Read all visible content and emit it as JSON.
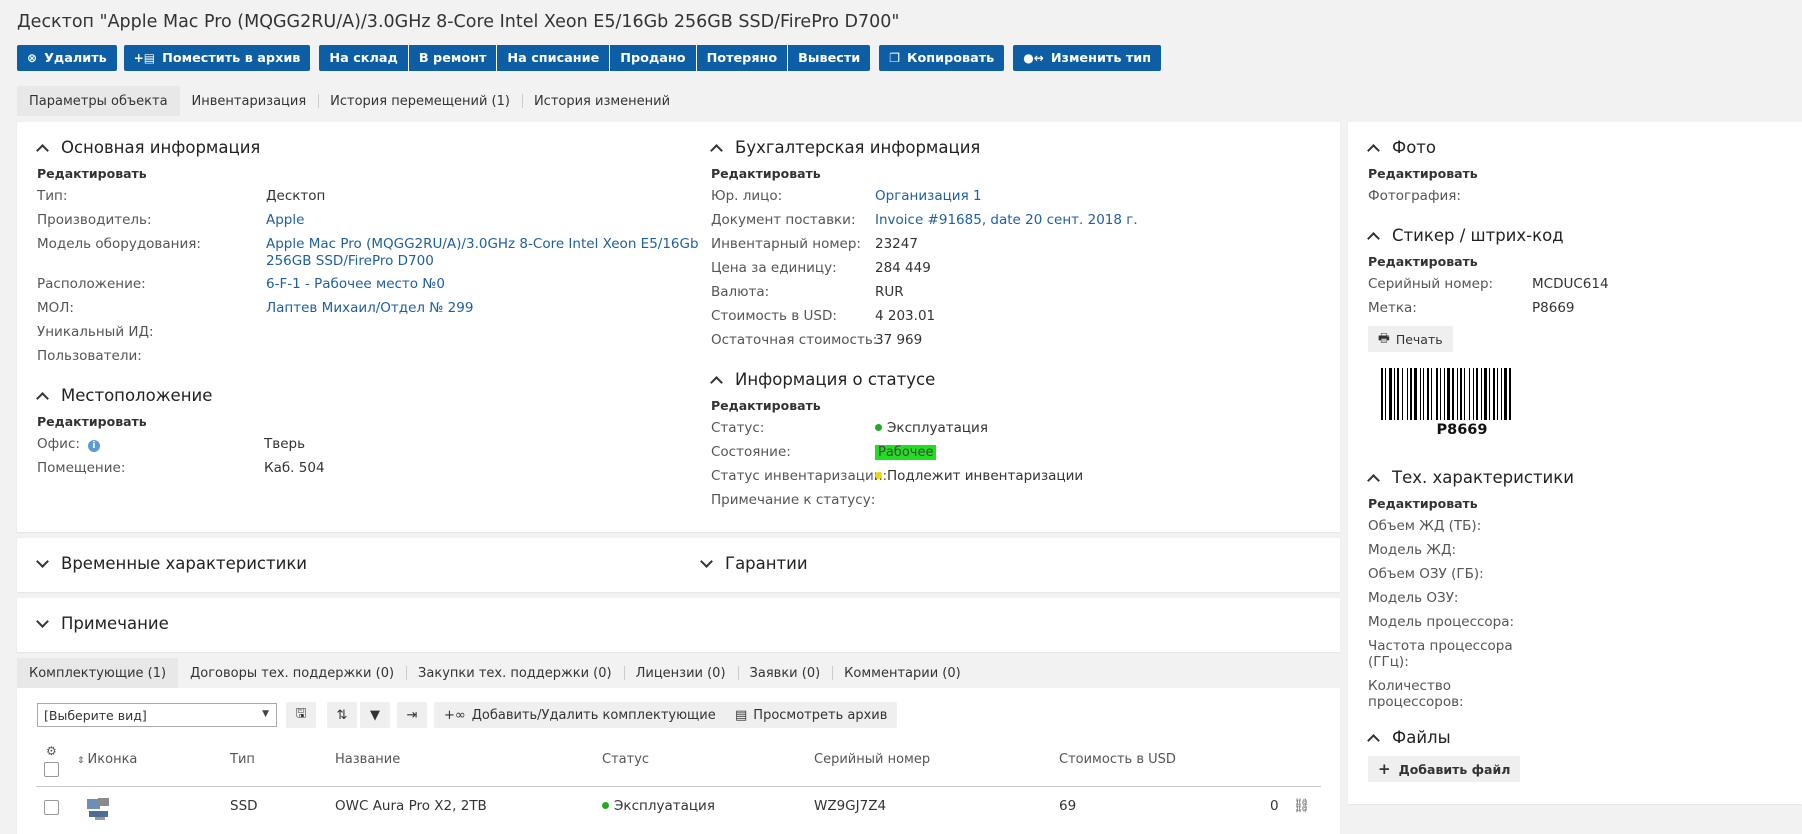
{
  "page": {
    "title": "Десктоп \"Apple Mac Pro (MQGG2RU/A)/3.0GHz 8-Core Intel Xeon E5/16Gb 256GB SSD/FirePro D700\""
  },
  "toolbar": {
    "delete": "Удалить",
    "archive": "Поместить в архив",
    "to_stock": "На склад",
    "to_repair": "В ремонт",
    "write_off": "На списание",
    "sold": "Продано",
    "lost": "Потеряно",
    "withdraw": "Вывести",
    "copy": "Копировать",
    "change_type": "Изменить тип"
  },
  "tabs": [
    "Параметры объекта",
    "Инвентаризация",
    "История перемещений (1)",
    "История изменений"
  ],
  "edit_label": "Редактировать",
  "basic": {
    "heading": "Основная информация",
    "type_label": "Тип:",
    "type_value": "Десктоп",
    "maker_label": "Производитель:",
    "maker_value": "Apple",
    "model_label": "Модель оборудования:",
    "model_value_1": "Apple Mac Pro (MQGG2RU/A)/3.0GHz 8-Core Intel Xeon E5/16Gb",
    "model_value_2": "256GB SSD/FirePro D700",
    "location_label": "Расположение:",
    "location_value": "6-F-1 - Рабочее место №0",
    "mol_label": "МОЛ:",
    "mol_value": "Лаптев Михаил/Отдел № 299",
    "uid_label": "Уникальный ИД:",
    "users_label": "Пользователи:"
  },
  "place": {
    "heading": "Местоположение",
    "office_label": "Офис:",
    "office_value": "Тверь",
    "room_label": "Помещение:",
    "room_value": "Каб. 504"
  },
  "accounting": {
    "heading": "Бухгалтерская информация",
    "entity_label": "Юр. лицо:",
    "entity_value": "Организация 1",
    "doc_label": "Документ поставки:",
    "doc_value": "Invoice #91685, date 20 сент. 2018 г.",
    "inv_label": "Инвентарный номер:",
    "inv_value": "23247",
    "price_label": "Цена за единицу:",
    "price_value": "284 449",
    "currency_label": "Валюта:",
    "currency_value": "RUR",
    "usd_label": "Стоимость в USD:",
    "usd_value": "4 203.01",
    "residual_label": "Остаточная стоимость:",
    "residual_value": "37 969"
  },
  "status": {
    "heading": "Информация о статусе",
    "status_label": "Статус:",
    "status_value": "Эксплуатация",
    "state_label": "Состояние:",
    "state_value": "Рабочее",
    "inv_label": "Статус инвентаризации:",
    "inv_value": "Подлежит инвентаризации",
    "note_label": "Примечание к статусу:",
    "colors": {
      "green": "#22aa22",
      "yellow": "#f0d800",
      "badge": "#22dd22"
    }
  },
  "collapsed": {
    "time": "Временные характеристики",
    "warranty": "Гарантии",
    "note": "Примечание"
  },
  "right": {
    "photo_heading": "Фото",
    "photo_label": "Фотография:",
    "sticker_heading": "Стикер / штрих-код",
    "serial_label": "Серийный номер:",
    "serial_value": "MCDUC614",
    "tag_label": "Метка:",
    "tag_value": "P8669",
    "print_label": "Печать",
    "barcode_text": "P8669",
    "tech_heading": "Тех. характеристики",
    "hdd_size": "Объем ЖД (ТБ):",
    "hdd_model": "Модель ЖД:",
    "ram_size": "Объем ОЗУ (ГБ):",
    "ram_model": "Модель ОЗУ:",
    "cpu_model": "Модель процессора:",
    "cpu_freq_1": "Частота процессора",
    "cpu_freq_2": "(ГГц):",
    "cpu_count_1": "Количество",
    "cpu_count_2": "процессоров:",
    "files_heading": "Файлы",
    "add_file": "Добавить файл"
  },
  "bottom_tabs": [
    "Комплектующие (1)",
    "Договоры тех. поддержки (0)",
    "Закупки тех. поддержки (0)",
    "Лицензии (0)",
    "Заявки (0)",
    "Комментарии (0)"
  ],
  "components": {
    "view_select": "[Выберите вид]",
    "add_remove": "Добавить/Удалить комплектующие",
    "view_archive": "Просмотреть архив",
    "columns": [
      "Иконка",
      "Тип",
      "Название",
      "Статус",
      "Серийный номер",
      "Стоимость в USD"
    ],
    "rows": [
      {
        "type": "SSD",
        "name": "OWC Aura Pro X2, 2TB",
        "status": "Эксплуатация",
        "serial": "WZ9GJ7Z4",
        "cost": "69",
        "count": "0"
      }
    ]
  },
  "colors": {
    "primary": "#0e5ea6",
    "link": "#1e5f9e"
  }
}
